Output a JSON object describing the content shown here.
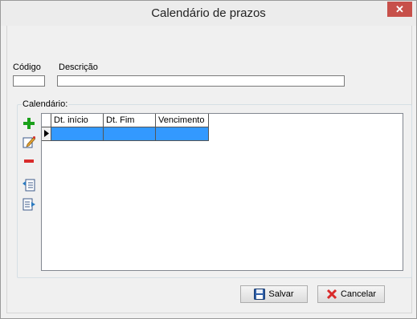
{
  "window": {
    "title": "Calendário de prazos",
    "close_glyph": "✕"
  },
  "fields": {
    "codigo_label": "Código",
    "codigo_value": "",
    "descricao_label": "Descrição",
    "descricao_value": ""
  },
  "calendario": {
    "group_label": "Calendário:",
    "toolbar": [
      "add-icon",
      "edit-icon",
      "remove-icon",
      "import-icon",
      "export-icon"
    ],
    "columns": [
      "Dt. início",
      "Dt. Fim",
      "Vencimento"
    ],
    "rows": [
      [
        "",
        "",
        ""
      ]
    ]
  },
  "buttons": {
    "save_label": "Salvar",
    "cancel_label": "Cancelar"
  },
  "colors": {
    "selection": "#3399ff",
    "close": "#c7504a",
    "add": "#1aa01a",
    "remove": "#d92b2b"
  }
}
